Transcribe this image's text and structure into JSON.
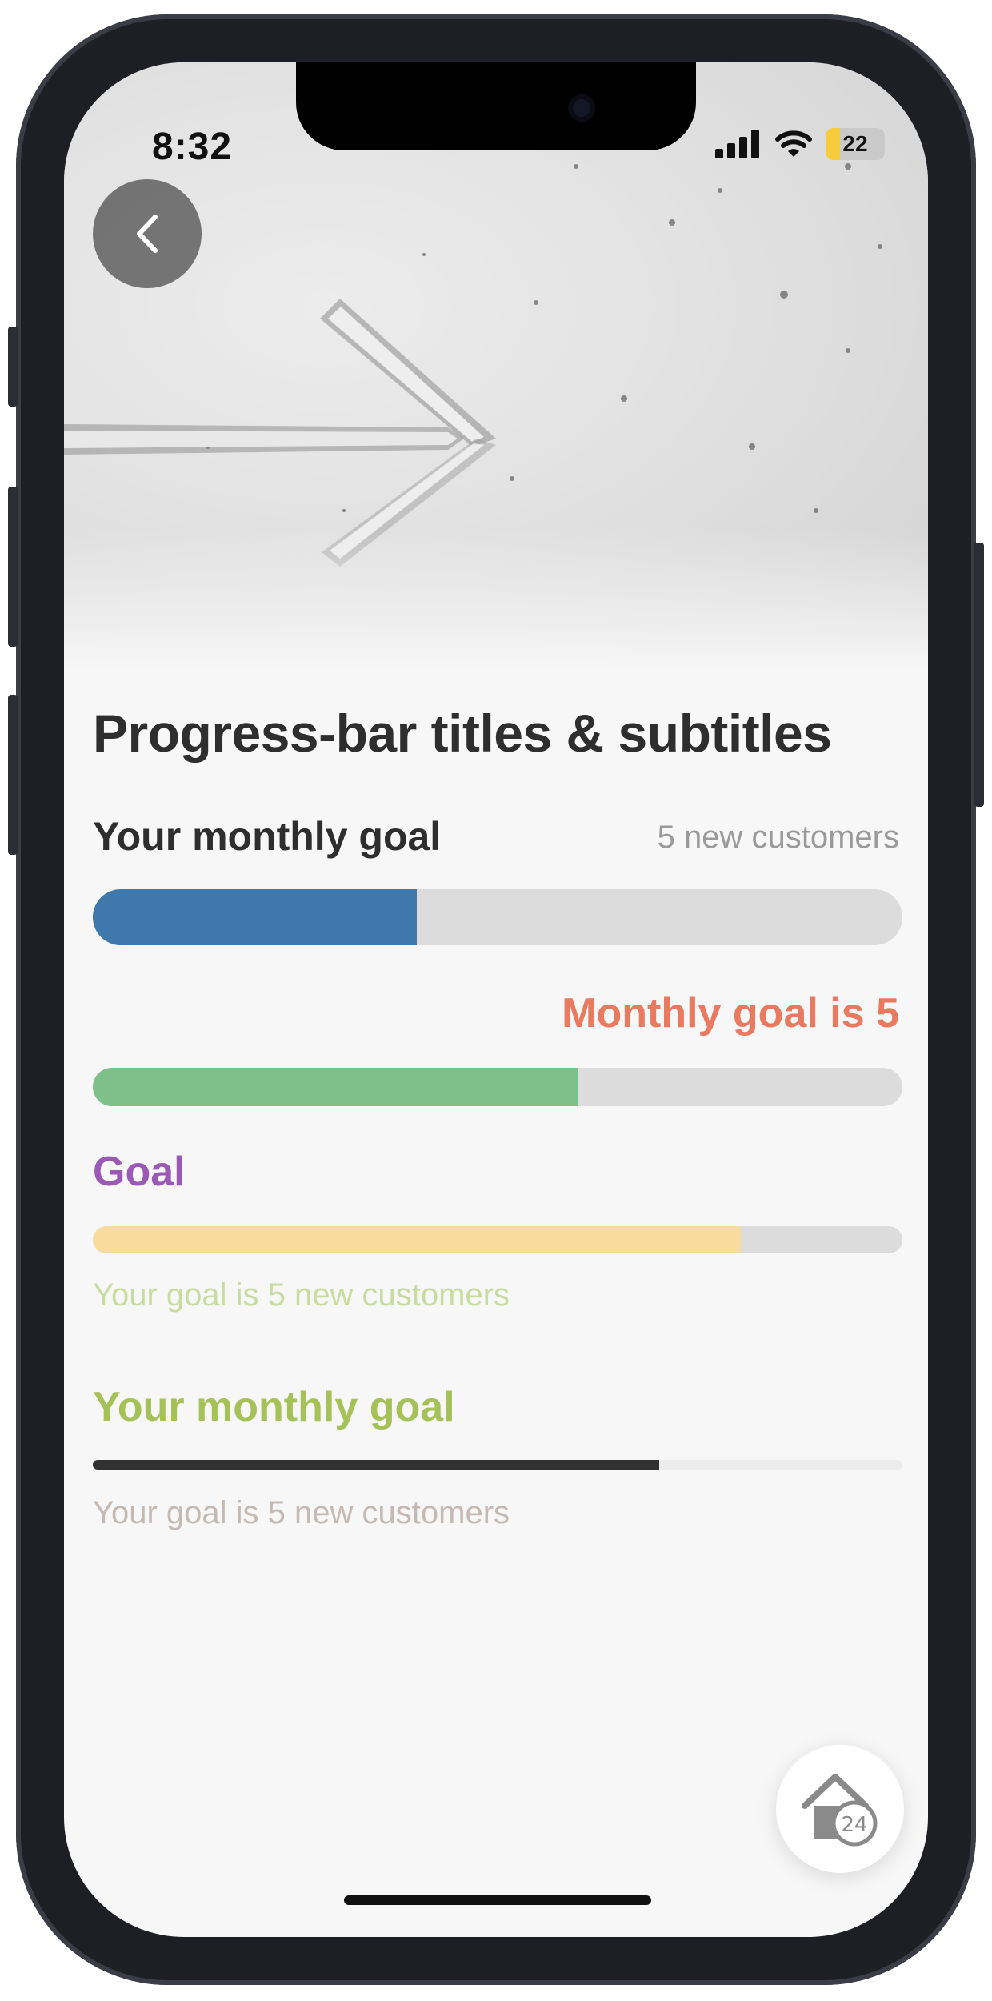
{
  "status_bar": {
    "time": "8:32",
    "battery": "22"
  },
  "page": {
    "title": "Progress-bar titles & subtitles"
  },
  "progress_bars": [
    {
      "title": "Your monthly goal",
      "title_color": "#2e2e2e",
      "subtitle": "5 new customers",
      "subtitle_color": "#9a9a9a",
      "progress": 0.4,
      "bar_color": "#3f78ab",
      "track_color": "#dcdcdc"
    },
    {
      "title": "Monthly goal is 5",
      "title_color": "#e97a5f",
      "progress": 0.6,
      "bar_color": "#7fc08a",
      "track_color": "#dcdcdc"
    },
    {
      "title": "Goal",
      "title_color": "#9b59b6",
      "subtitle": "Your goal is 5 new customers",
      "subtitle_color": "#c8dc9f",
      "progress": 0.8,
      "bar_color": "#f8dc9f",
      "track_color": "#dcdcdc"
    },
    {
      "title": "Your monthly goal",
      "title_color": "#a6c157",
      "subtitle": "Your goal is 5 new customers",
      "subtitle_color": "#c4b9b3",
      "progress": 0.7,
      "bar_color": "#323232",
      "track_color": "#ececec"
    }
  ],
  "fab": {
    "icon": "home-icon",
    "badge": "24"
  }
}
